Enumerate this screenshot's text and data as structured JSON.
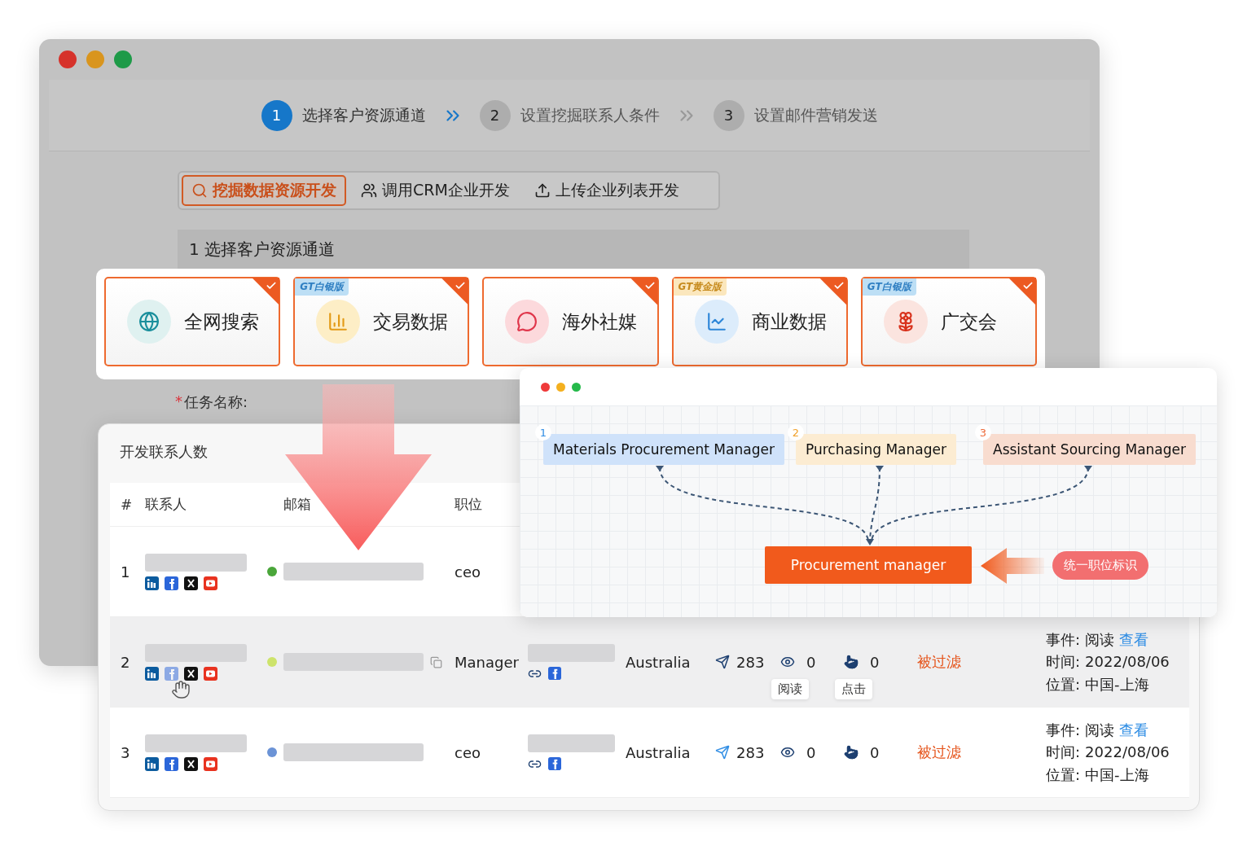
{
  "setup_window": {
    "steps": [
      {
        "number": "1",
        "label": "选择客户资源通道",
        "selected": true
      },
      {
        "number": "2",
        "label": "设置挖掘联系人条件",
        "selected": false
      },
      {
        "number": "3",
        "label": "设置邮件营销发送",
        "selected": false
      }
    ],
    "mode_tabs": [
      {
        "label": "挖掘数据资源开发",
        "selected": true
      },
      {
        "label": "调用CRM企业开发",
        "selected": false
      },
      {
        "label": "上传企业列表开发",
        "selected": false
      }
    ],
    "section_title": "1 选择客户资源通道",
    "required_mark": "*",
    "task_name_label": "任务名称:"
  },
  "channels": [
    {
      "label": "全网搜索",
      "checked": true
    },
    {
      "label": "交易数据",
      "checked": true,
      "badge": {
        "text": "GT白银版",
        "kind": "silver"
      }
    },
    {
      "label": "海外社媒",
      "checked": true
    },
    {
      "label": "商业数据",
      "checked": true,
      "badge": {
        "text": "GT黄金版",
        "kind": "gold"
      }
    },
    {
      "label": "广交会",
      "checked": true,
      "badge": {
        "text": "GT白银版",
        "kind": "silver"
      }
    }
  ],
  "contacts_table": {
    "title": "开发联系人数",
    "columns": [
      "#",
      "联系人",
      "邮箱",
      "职位"
    ],
    "rows": [
      {
        "number": "1",
        "color": "#4aa63a",
        "position": "ceo",
        "hovered": false
      },
      {
        "number": "2",
        "color": "#cde36b",
        "position": "Manager",
        "hovered": true,
        "country": "Australia",
        "sent": "283",
        "reads": "0",
        "clicks": "0",
        "reads_tooltip": "阅读",
        "clicks_tooltip": "点击",
        "status": "被过滤",
        "event_label": "事件:",
        "event": "阅读",
        "view_link": "查看",
        "time_label": "时间:",
        "time": "2022/08/06",
        "location_label": "位置:",
        "location": "中国-上海"
      },
      {
        "number": "3",
        "color": "#6b93d6",
        "position": "ceo",
        "hovered": false,
        "country": "Australia",
        "sent": "283",
        "reads": "0",
        "clicks": "0",
        "status": "被过滤",
        "event_label": "事件:",
        "event": "阅读",
        "view_link": "查看",
        "time_label": "时间:",
        "time": "2022/08/06",
        "location_label": "位置:",
        "location": "中国-上海"
      }
    ]
  },
  "title_diagram": {
    "sources": [
      {
        "number": "1",
        "label": "Materials Procurement Manager",
        "color": "#cfe2fa"
      },
      {
        "number": "2",
        "label": "Purchasing Manager",
        "color": "#fcecd2"
      },
      {
        "number": "3",
        "label": "Assistant Sourcing Manager",
        "color": "#f8dccf"
      }
    ],
    "target": "Procurement manager",
    "tag": "统一职位标识"
  }
}
